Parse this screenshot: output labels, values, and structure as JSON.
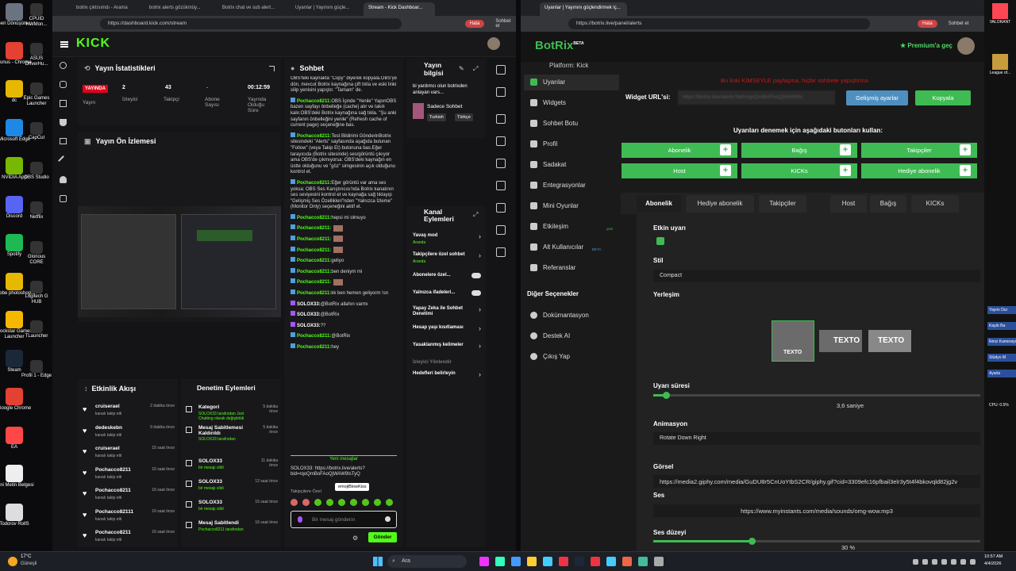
{
  "desktop": {
    "left_icons": [
      {
        "label": "Geri Dönüşüm...",
        "color": "#6b7280"
      },
      {
        "label": "Yunus - Chrome",
        "color": "#e34133"
      },
      {
        "label": "dc",
        "color": "#e6b800"
      },
      {
        "label": "Microsoft Edge",
        "color": "#1e88e5"
      },
      {
        "label": "NVIDIA App",
        "color": "#76b900"
      },
      {
        "label": "Discord",
        "color": "#5865f2"
      },
      {
        "label": "Spotify",
        "color": "#1db954"
      },
      {
        "label": "Adobe photoshop...",
        "color": "#e6b800"
      },
      {
        "label": "Rockstar Games Launcher",
        "color": "#f5b700"
      },
      {
        "label": "Steam",
        "color": "#1b2838"
      },
      {
        "label": "Google Chrome",
        "color": "#e34133"
      },
      {
        "label": "EA",
        "color": "#ff4747"
      },
      {
        "label": "Yeni Metin Belgesi",
        "color": "#eeeeee"
      },
      {
        "label": "Todorov RollS",
        "color": "#dddddd"
      }
    ],
    "second_col": [
      {
        "label": "CPUID HWMon..."
      },
      {
        "label": "ASUS DriverHu..."
      },
      {
        "label": "Epic Games Launcher"
      },
      {
        "label": "CapCut"
      },
      {
        "label": "OBS Studio"
      },
      {
        "label": "Netflix"
      },
      {
        "label": "Glorious CORE"
      },
      {
        "label": "Logitech G HUB"
      },
      {
        "label": "TLauncher"
      },
      {
        "label": "Profil 1 - Edge"
      }
    ],
    "right_col": [
      {
        "label": "VALORANT"
      },
      {
        "label": "League of..."
      }
    ]
  },
  "left_window": {
    "tabs": [
      "botrix çıktısımdı - Arama",
      "botrix alerts gözükmüy...",
      "Botrix chat ve sub alert...",
      "Uyarılar | Yayınını güçle...",
      "Stream - Kick Dashboar..."
    ],
    "active_tab": 4,
    "url": "https://dashboard.kick.com/stream",
    "profile_badge": "Hata",
    "sohbet_btn": "Sohbet et"
  },
  "kick": {
    "logo": "KICK",
    "stats": {
      "title": "Yayın İstatistikleri",
      "live": "YAYINDA",
      "live_sub": "Yayın",
      "viewers": "2",
      "viewers_l": "İzleyici",
      "followers": "43",
      "followers_l": "Takipçi",
      "subs": "-",
      "subs_l": "Abone Sayısı",
      "time": "00:12:59",
      "time_l": "Yayında Olduğu Süre"
    },
    "preview": {
      "title": "Yayın Ön İzlemesi"
    },
    "activity": {
      "title": "Etkinlik Akışı",
      "items": [
        {
          "name": "cruiserael",
          "act": "kanalı takip etti",
          "time": "2 dakika önce"
        },
        {
          "name": "dedeskebn",
          "act": "kanalı takip etti",
          "time": "9 dakika önce"
        },
        {
          "name": "cruiserael",
          "act": "kanalı takip etti",
          "time": "15 saat önce"
        },
        {
          "name": "Pochacco8211",
          "act": "kanalı takip etti",
          "time": "15 saat önce"
        },
        {
          "name": "Pochacco8211",
          "act": "kanalı takip etti",
          "time": "16 saat önce"
        },
        {
          "name": "Pochacco82111",
          "act": "kanalı takip etti",
          "time": "16 saat önce"
        },
        {
          "name": "Pochacco8211",
          "act": "kanalı takip etti",
          "time": "16 saat önce"
        }
      ]
    },
    "moderation": {
      "title": "Denetim Eylemleri",
      "items": [
        {
          "title": "Kategori",
          "l1": "SOLOX33 tarafından Just Chatting olarak değiştirildi",
          "time": "5 dakika önce"
        },
        {
          "title": "Mesaj Sabitlemesi Kaldırıldı",
          "l1": "SOLOX33 tarafından",
          "time": "5 dakika önce"
        },
        {
          "title": "SOLOX33",
          "l1": "bir mesajı sildi",
          "time": "11 dakika önce"
        },
        {
          "title": "SOLOX33",
          "l1": "bir mesajı sildi",
          "time": "12 saat önce"
        },
        {
          "title": "SOLOX33",
          "l1": "bir mesajı sildi",
          "time": "15 saat önce"
        },
        {
          "title": "Mesaj Sabitlendi",
          "l1": "Pochacco8211 tarafından",
          "time": "16 saat önce"
        }
      ]
    },
    "chat": {
      "title": "Sohbet",
      "messages": [
        {
          "u": "",
          "t": "OBS'teki kaynakta \"Copy\" diyerek kopyala.OBS'ye dön, mevcut Botrix kaynağına çift tıkla ve eski linki silip yenisini yapıştır. \"Tamam\" de."
        },
        {
          "u": "Pochacco8211:",
          "t": "OBS İçinde \"Yenile\" YapınOBS bazen sayfayı önbelleğe (cache) alır ve takılı kalır.OBS'deki Botrix kaynağına sağ tıkla. \"Şu anki sayfanın önbelleğini yenile\" (Refresh cache of current page) seçeneğine bas."
        },
        {
          "u": "Pochacco8211:",
          "t": "Test Bildirimi GönderinBotrix sitesindeki \"Alerts\" sayfasında aşağıda bulunan \"Follow\" (veya Takip Et) butonuna bas.Eğer tarayıcıda (Botrix sitesinde) ses/görüntü çıkıyor ama OBS'de çıkmıyorsa: OBS'deki kaynağın en üstte olduğunu ve \"göz\" simgesinin açık olduğunu kontrol et."
        },
        {
          "u": "Pochacco8211:",
          "t": "Eğer görüntü var ama ses yoksa: OBS Ses Karıştırıcısı'nda Botrix kanalının ses seviyesini kontrol et ve kaynağa sağ tıklayıp \"Gelişmiş Ses Özellikleri\"nden \"Yalnızca İzleme\" (Monitor Only) seçeneğini aktif et."
        },
        {
          "u": "Pochacco8211:",
          "t": "hepsi mi olmuyo"
        },
        {
          "u": "Pochacco8211:",
          "t": ""
        },
        {
          "u": "Pochacco8211:",
          "t": ""
        },
        {
          "u": "Pochacco8211:",
          "t": ""
        },
        {
          "u": "Pochacco8211:",
          "t": "geliyo"
        },
        {
          "u": "Pochacco8211:",
          "t": "ben deniym mi"
        },
        {
          "u": "Pochacco8211:",
          "t": ""
        },
        {
          "u": "Pochacco8211:",
          "t": "kk ben hemen geliyorm !sn"
        },
        {
          "u": "SOLOX33:",
          "t": "@BotRix allahın varmı"
        },
        {
          "u": "SOLOX33:",
          "t": "@BotRix"
        },
        {
          "u": "SOLOX33:",
          "t": "??"
        },
        {
          "u": "Pochacco8211:",
          "t": "@BotRix"
        },
        {
          "u": "Pochacco8211:",
          "t": "hey"
        }
      ],
      "new_msgs": "Yeni mesajlar",
      "last": "SOLOX33: https://botrix.live/alerts?bid=rqoQmBoFAoQjWAW9IsTyQ",
      "tooltip": "emojiBlowKiss",
      "followers_only": "Takipçilere Özel",
      "input_ph": "Bir mesaj gönderin",
      "send": "Gönder"
    },
    "info": {
      "title": "Yayın bilgisi",
      "text": "bi yardımcı olun botrixden anlayan vars...",
      "cat": "Sadece Sohbet",
      "tags": [
        "Turkish",
        "Türkçe"
      ]
    },
    "channel": {
      "title": "Kanal Eylemleri",
      "items": [
        {
          "l": "Yavaş mod",
          "s": "Aranda"
        },
        {
          "l": "Takipçilere özel sohbet",
          "s": "Aranda"
        },
        {
          "l": "Abonelere özel...",
          "s": ""
        },
        {
          "l": "Yalnızca ifadeleri...",
          "s": ""
        },
        {
          "l": "Yapay Zeka ile Sohbet Denetimi",
          "s": ""
        },
        {
          "l": "Hesap yaşı kısıtlaması",
          "s": ""
        },
        {
          "l": "Yasaklanmış kelimeler",
          "s": ""
        },
        {
          "l": "İzleyici Yönlendir",
          "s": ""
        },
        {
          "l": "Hedefleri belirleyin",
          "s": ""
        }
      ]
    }
  },
  "right_window": {
    "tab": "Uyarılar | Yayınını güçlendirmek iç...",
    "url": "https://botrix.live/panel/alerts",
    "profile_badge": "Hata",
    "sohbet_btn": "Sohbet et"
  },
  "botrix": {
    "logo": "BotRix",
    "beta": "BETA",
    "premium": "Premium'a geç",
    "platform": "Platform: Kick",
    "nav": [
      "Uyarılar",
      "Widgets",
      "Sohbet Botu",
      "Profil",
      "Sadakat",
      "Entegrasyonlar",
      "Mini Oyunlar",
      "Etkileşim",
      "Alt Kullanıcılar",
      "Referanslar"
    ],
    "nav_badges": {
      "etkilesim": "yeni",
      "alt": "BETA"
    },
    "other_title": "Diğer Seçenekler",
    "other": [
      "Dokümantasyon",
      "Destek AI",
      "Çıkış Yap"
    ],
    "warning": "Bu linki KİMSEYLE paylaşma, hiçbir sohbete yapıştırma",
    "widget_label": "Widget URL'si:",
    "widget_url": "https://botrix.live/alerts?bid=rqoQmBoFAoQjWAW9Is",
    "adv_btn": "Gelişmiş ayarlar",
    "copy_btn": "Kopyala",
    "test_title": "Uyarıları denemek için aşağıdaki butonları kullan:",
    "test_btns": [
      "Abonelik",
      "Bağış",
      "Takipçiler",
      "Host",
      "KICKs",
      "Hediye abonelik"
    ],
    "tabs": [
      "Abonelik",
      "Hediye abonelik",
      "Takipçiler",
      "Host",
      "Bağış",
      "KICKs"
    ],
    "active_tab": 0,
    "form": {
      "enable": "Etkin uyarı",
      "style_l": "Stil",
      "style": "Compact",
      "layout_l": "Yerleşim",
      "layout_txt": "TEXTO",
      "duration_l": "Uyarı süresi",
      "duration": "3,6 saniye",
      "duration_val": 0.04,
      "anim_l": "Animasyon",
      "anim": "Rotate Down Right",
      "gif_l": "Görsel",
      "gif": "https://media2.giphy.com/media/GuDU8r5CnUoYtbS2CR/giphy.gif?cid=3309efc16pfbail3elr3y5t4f4bkovqld82jg2v",
      "sound_l": "Ses",
      "sound": "https://www.myinstants.com/media/sounds/omg-wow.mp3",
      "vol_l": "Ses düzeyi",
      "vol": "30 %",
      "vol_val": 0.3
    }
  },
  "right_edge": {
    "items": [
      "Yayını Dur",
      "Kaydı Ba",
      "İkinci Kamerayı",
      "Stüdyo M",
      "Ayarla",
      "CPU: 0.5%"
    ]
  },
  "taskbar": {
    "weather": "17°C",
    "weather_sub": "Güneşli",
    "search": "Ara",
    "time": "10:57 AM",
    "date": "4/4/2026"
  }
}
